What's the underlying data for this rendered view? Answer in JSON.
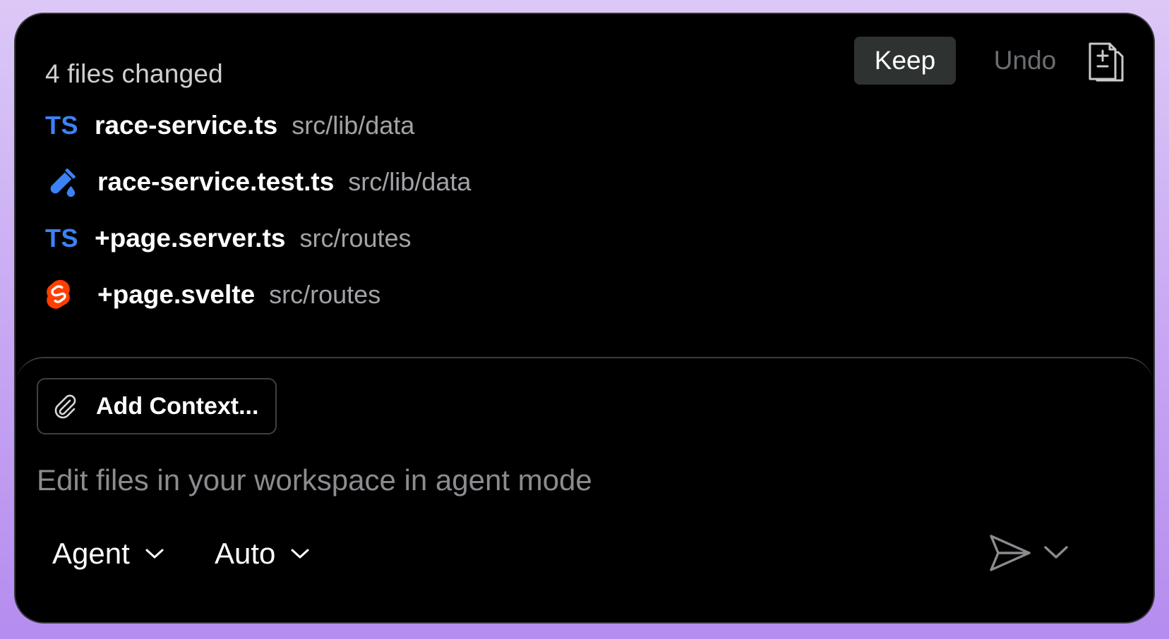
{
  "header": {
    "title": "4 files changed",
    "keep_label": "Keep",
    "undo_label": "Undo",
    "diff_icon": "file-diff-icon"
  },
  "files": [
    {
      "icon": "typescript-icon",
      "icon_text": "TS",
      "name": "race-service.ts",
      "path": "src/lib/data"
    },
    {
      "icon": "test-tube-icon",
      "name": "race-service.test.ts",
      "path": "src/lib/data"
    },
    {
      "icon": "typescript-icon",
      "icon_text": "TS",
      "name": "+page.server.ts",
      "path": "src/routes"
    },
    {
      "icon": "svelte-icon",
      "name": "+page.svelte",
      "path": "src/routes"
    }
  ],
  "composer": {
    "add_context_label": "Add Context...",
    "input_placeholder": "Edit files in your workspace in agent mode",
    "mode_label": "Agent",
    "model_label": "Auto"
  },
  "colors": {
    "ts_blue": "#3b82f6",
    "svelte_red": "#ff3e00",
    "keep_bg": "#2e3230",
    "panel_bg": "#000000",
    "frame_gradient_top": "#dcc8f7",
    "frame_gradient_bottom": "#b58cef"
  }
}
